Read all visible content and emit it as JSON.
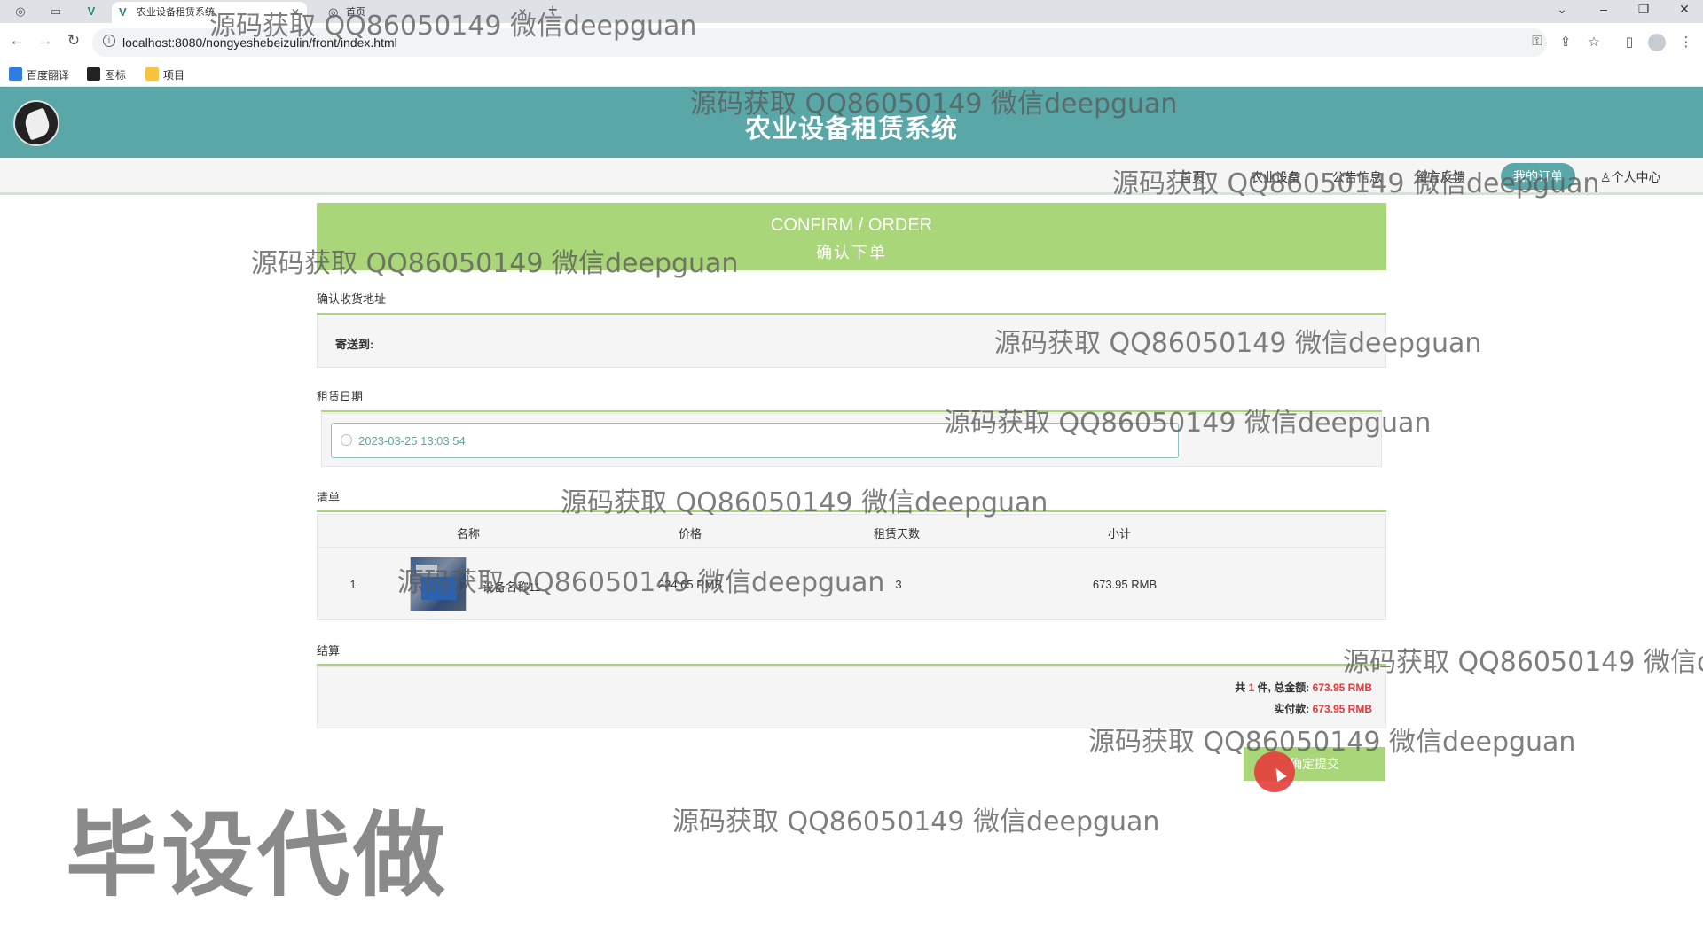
{
  "browser": {
    "tabs": [
      {
        "label": "农业设备租赁系统",
        "active": true
      },
      {
        "label": "首页",
        "active": false
      }
    ],
    "url": "localhost:8080/nongyeshebeizulin/front/index.html",
    "bookmarks": [
      "百度翻译",
      "图标",
      "项目"
    ]
  },
  "site": {
    "title": "农业设备租赁系统",
    "nav": [
      {
        "label": "首页",
        "active": false
      },
      {
        "label": "农业设备",
        "active": false
      },
      {
        "label": "公告信息",
        "active": false
      },
      {
        "label": "留言反馈",
        "active": false
      },
      {
        "label": "我的订单",
        "active": true
      },
      {
        "label": "个人中心",
        "active": false
      }
    ]
  },
  "order": {
    "banner_en": "CONFIRM / ORDER",
    "banner_cn": "确认下单",
    "address_section": "确认收货地址",
    "ship_to_label": "寄送到:",
    "date_section": "租赁日期",
    "date_value": "2023-03-25 13:03:54",
    "list_section": "清单",
    "columns": [
      "名称",
      "价格",
      "租赁天数",
      "小计"
    ],
    "items": [
      {
        "index": "1",
        "name": "设备名称11",
        "price": "224.65 RMB",
        "days": "3",
        "subtotal": "673.95 RMB"
      }
    ],
    "settle_section": "结算",
    "summary_prefix": "共",
    "summary_count": "1",
    "summary_mid": "件, 总金额:",
    "total": "673.95 RMB",
    "paid_label": "实付款:",
    "paid": "673.95 RMB",
    "submit_label": "确定提交"
  },
  "watermarks": {
    "text": "源码获取 QQ86050149 微信deepguan",
    "cut": "源码获取 QQ86050149 微信d",
    "big": "毕设代做"
  },
  "colors": {
    "header": "#5aa7a7",
    "accent_green": "#a8d679",
    "price_red": "#e4393c"
  }
}
